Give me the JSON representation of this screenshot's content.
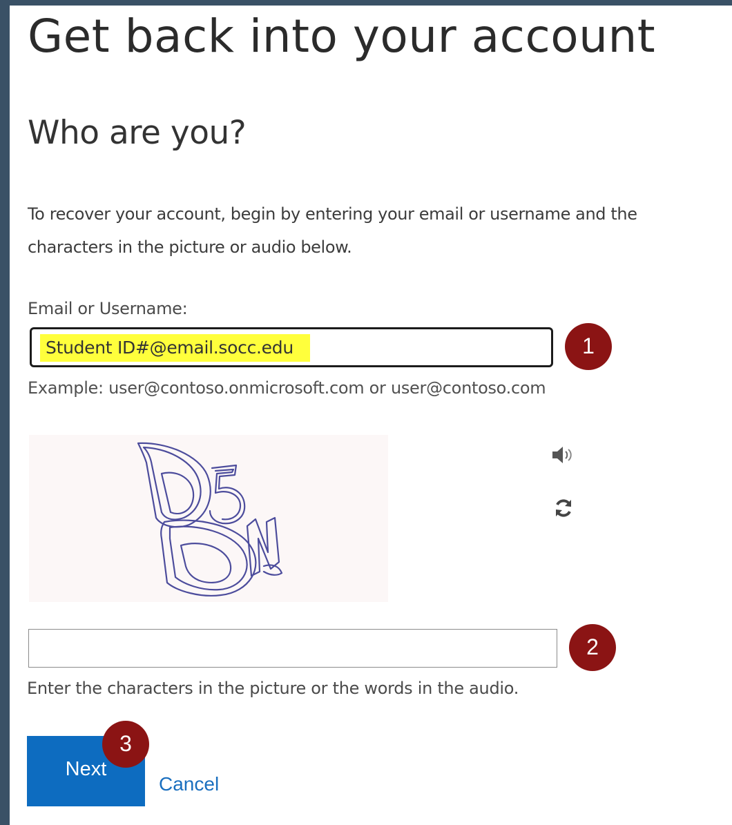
{
  "page": {
    "title": "Get back into your account",
    "subtitle": "Who are you?",
    "instructions": "To recover your account, begin by entering your email or username and the characters in the picture or audio below."
  },
  "email": {
    "label": "Email or Username:",
    "value": "Student ID#@email.socc.edu",
    "example": "Example: user@contoso.onmicrosoft.com or user@contoso.com",
    "highlight_color": "#ffff3c"
  },
  "captcha": {
    "characters": "D5DN",
    "audio_icon": "speaker-icon",
    "refresh_icon": "refresh-icon",
    "input_value": "",
    "hint": "Enter the characters in the picture or the words in the audio."
  },
  "actions": {
    "next_label": "Next",
    "cancel_label": "Cancel"
  },
  "annotations": {
    "step1": "1",
    "step2": "2",
    "step3": "3",
    "badge_color": "#8b1414"
  },
  "colors": {
    "primary_button": "#0d6cc0",
    "link": "#1a6fbf",
    "frame": "#3a5166"
  }
}
